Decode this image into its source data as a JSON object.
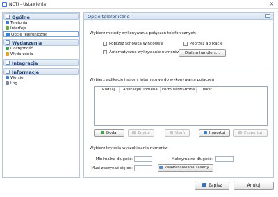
{
  "window": {
    "title": "NCTI - Ustawienia",
    "close_glyph": "✕"
  },
  "sidebar": {
    "sections": [
      {
        "label": "Ogólne",
        "icon": "general-icon",
        "items": [
          {
            "label": "Telefonia",
            "icon": "phone-icon",
            "color": "#3b7fd0"
          },
          {
            "label": "Interfejs",
            "icon": "interface-icon",
            "color": "#6aa84f"
          },
          {
            "label": "Opcje telefoniczne",
            "icon": "phone-options-icon",
            "color": "#3b7fd0",
            "selected": true
          }
        ]
      },
      {
        "label": "Wydarzenia",
        "icon": "events-icon",
        "items": [
          {
            "label": "Dostępność",
            "icon": "availability-icon",
            "color": "#3aa655"
          },
          {
            "label": "Wydarzenia",
            "icon": "event-icon",
            "color": "#e0a526"
          }
        ]
      },
      {
        "label": "Integracja",
        "icon": "integration-icon",
        "items": []
      },
      {
        "label": "Informacje",
        "icon": "info-icon",
        "items": [
          {
            "label": "Wersje",
            "icon": "versions-icon",
            "color": "#4a7fc1"
          },
          {
            "label": "Log",
            "icon": "log-icon",
            "color": "#7a8899"
          }
        ]
      }
    ]
  },
  "main": {
    "header": "Opcje telefoniczne",
    "dial_group": {
      "label": "Wybierz metody wykonywania połączeń telefonicznych:",
      "options": {
        "clipboard": "Poprzez schowka Windows'a",
        "app": "Poprzez aplikację",
        "auto": "Automatyczne wykrywanie numerów"
      },
      "handlers_button": "Dialing handlers..."
    },
    "apps_group": {
      "label": "Wybierz aplikacje i strony internetowe do wykonywania połączeń",
      "columns": [
        "Rodzaj",
        "Aplikacja/Domena",
        "Formularz/Strona",
        "Tekst"
      ],
      "buttons": {
        "add": "Dodaj",
        "edit": "Edytuj",
        "delete": "Usuń",
        "import": "Importuj",
        "export": "Eksportuj"
      }
    },
    "search_group": {
      "label": "Wybierz kryteria wyszukiwania numerów",
      "min_length_label": "Minimalna długość:",
      "max_length_label": "Maksymalna długość:",
      "starts_with_label": "Musi zaczynać się od:",
      "advanced_button": "Zaawansowane zasady..."
    }
  },
  "footer": {
    "save": "Zapisz",
    "cancel": "Anuluj"
  }
}
